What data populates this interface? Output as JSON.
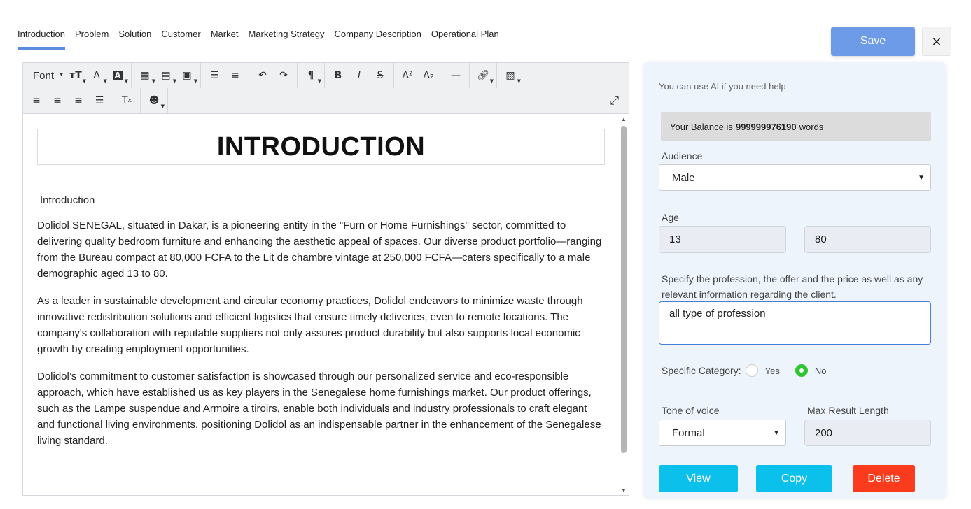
{
  "tabs": [
    "Introduction",
    "Problem",
    "Solution",
    "Customer",
    "Market",
    "Marketing Strategy",
    "Company Description",
    "Operational Plan"
  ],
  "header": {
    "save_label": "Save",
    "close_label": "×"
  },
  "editor": {
    "toolbar": {
      "font_label": "Font"
    },
    "title": "INTRODUCTION",
    "intro_label": "Introduction",
    "paragraphs": [
      "Dolidol SENEGAL, situated in Dakar, is a pioneering entity in the \"Furn or Home Furnishings\" sector, committed to delivering quality bedroom furniture and enhancing the aesthetic appeal of spaces. Our diverse product portfolio—ranging from the Bureau compact at 80,000 FCFA to the Lit de chambre vintage at 250,000 FCFA—caters specifically to a male demographic aged 13 to 80.",
      "As a leader in sustainable development and circular economy practices, Dolidol endeavors to minimize waste through innovative redistribution solutions and efficient logistics that ensure timely deliveries, even to remote locations. The company's collaboration with reputable suppliers not only assures product durability but also supports local economic growth by creating employment opportunities.",
      "Dolidol’s commitment to customer satisfaction is showcased through our personalized service and eco-responsible approach, which have established us as key players in the Senegalese home furnishings market. Our product offerings, such as the Lampe suspendue and Armoire a tiroirs, enable both individuals and industry professionals to craft elegant and functional living environments, positioning Dolidol as an indispensable partner in the enhancement of the Senegalese living standard."
    ]
  },
  "panel": {
    "hint": "You can use AI if you need help",
    "balance_prefix": "Your Balance is",
    "balance_value": "999999976190",
    "balance_suffix": "words",
    "audience_label": "Audience",
    "audience_value": "Male",
    "age_label": "Age",
    "age_min": "13",
    "age_max": "80",
    "profession_label": "Specify the profession, the offer and the price as well as any relevant information regarding the client.",
    "profession_value": "all type of profession",
    "category_label": "Specific Category:",
    "category_yes": "Yes",
    "category_no": "No",
    "tone_label": "Tone of voice",
    "tone_value": "Formal",
    "max_label": "Max Result Length",
    "max_value": "200",
    "view_label": "View",
    "copy_label": "Copy",
    "delete_label": "Delete"
  }
}
